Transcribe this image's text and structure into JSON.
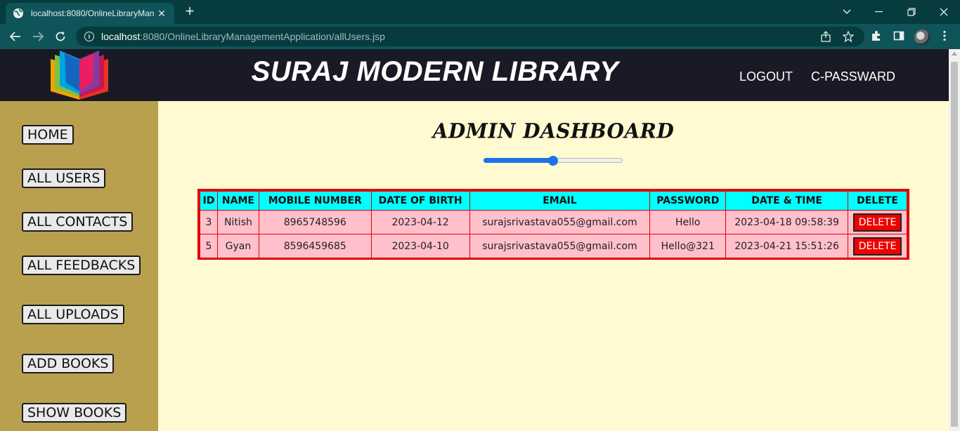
{
  "browser": {
    "tab_title": "localhost:8080/OnlineLibraryMan",
    "url_host": "localhost",
    "url_rest": ":8080/OnlineLibraryManagementApplication/allUsers.jsp"
  },
  "header": {
    "title": "SURAJ MODERN LIBRARY",
    "nav": {
      "logout": "LOGOUT",
      "change_password": "C-PASSWARD"
    }
  },
  "sidebar": {
    "items": [
      "HOME",
      "ALL USERS",
      "ALL CONTACTS",
      "ALL FEEDBACKS",
      "ALL UPLOADS",
      "ADD BOOKS",
      "SHOW BOOKS"
    ]
  },
  "main": {
    "title": "ADMIN DASHBOARD",
    "slider_value_percent": 50
  },
  "users_table": {
    "columns": [
      "ID",
      "NAME",
      "MOBILE NUMBER",
      "DATE OF BIRTH",
      "EMAIL",
      "PASSWORD",
      "DATE & TIME",
      "DELETE"
    ],
    "rows": [
      {
        "id": "3",
        "name": "Nitish",
        "mobile": "8965748596",
        "dob": "2023-04-12",
        "email": "surajsrivastava055@gmail.com",
        "password": "Hello",
        "datetime": "2023-04-18 09:58:39",
        "action": "DELETE"
      },
      {
        "id": "5",
        "name": "Gyan",
        "mobile": "8596459685",
        "dob": "2023-04-10",
        "email": "surajsrivastava055@gmail.com",
        "password": "Hello@321",
        "datetime": "2023-04-21 15:51:26",
        "action": "DELETE"
      }
    ]
  },
  "colors": {
    "header_bg": "#1a1a26",
    "sidebar_bg": "#b9a04e",
    "page_bg": "#fffad1",
    "table_header_bg": "#00ffff",
    "table_row_bg": "#ffc0cb",
    "table_border": "#e00000",
    "delete_button": "#ee0000"
  }
}
